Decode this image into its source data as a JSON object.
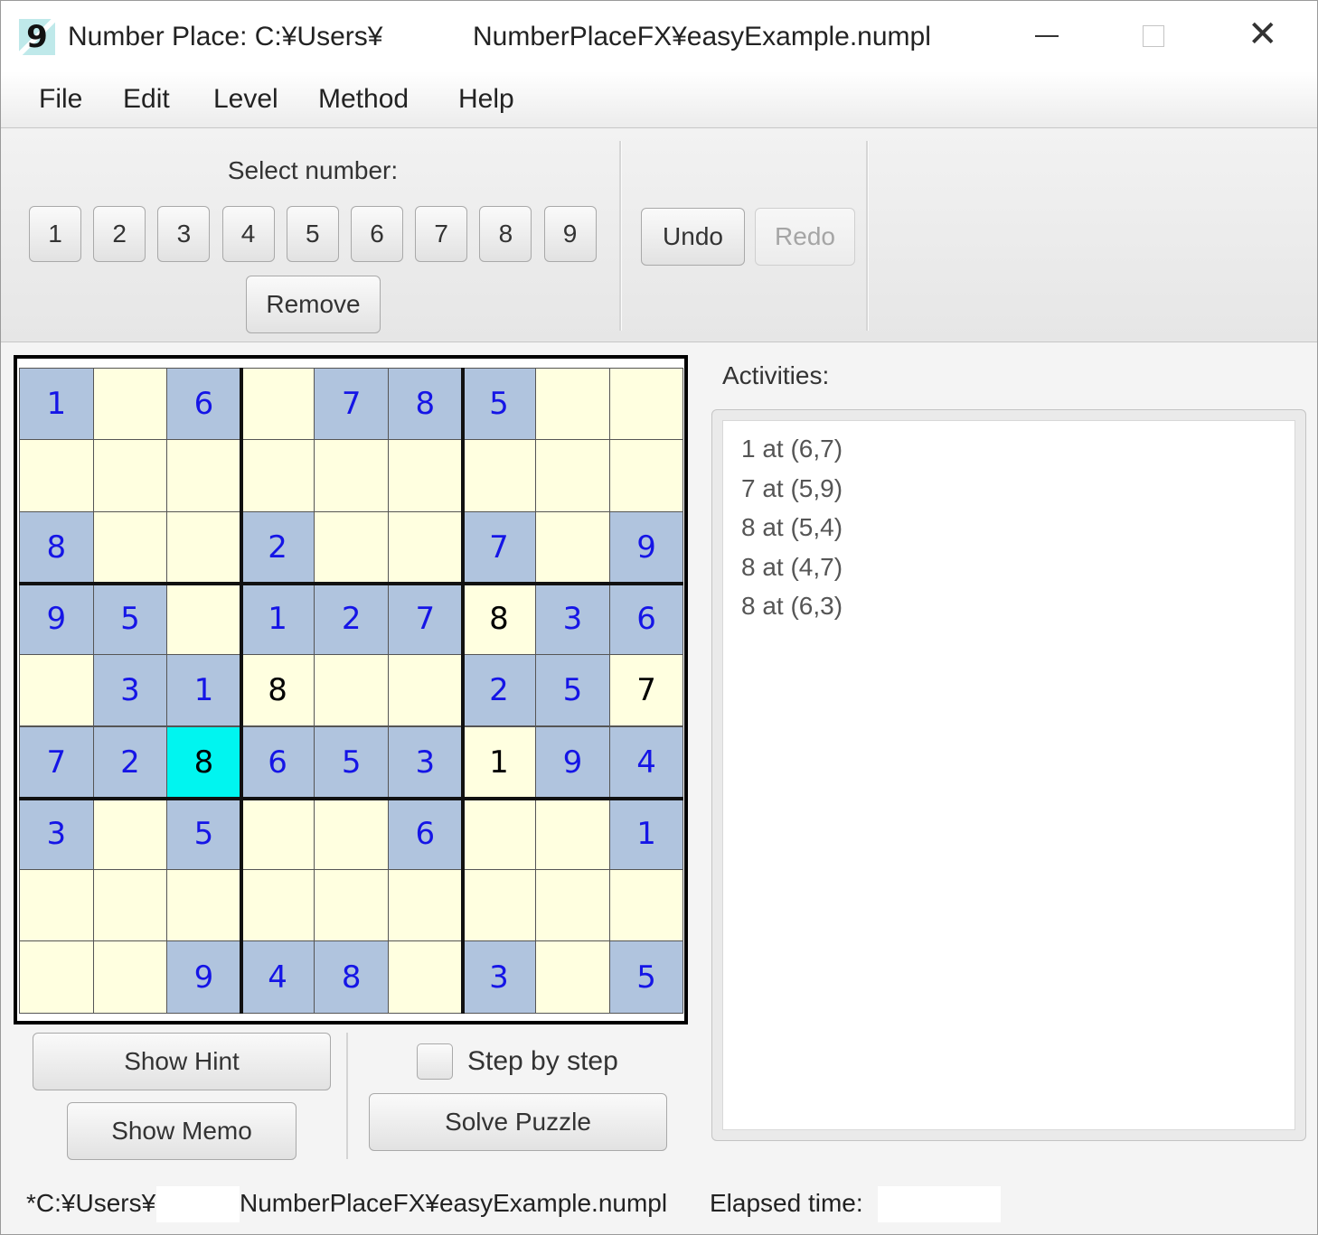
{
  "window": {
    "app_icon": "9",
    "title_left": "Number Place: C:¥Users¥",
    "title_right": "NumberPlaceFX¥easyExample.numpl",
    "close_glyph": "✕"
  },
  "menu": [
    "File",
    "Edit",
    "Level",
    "Method",
    "Help"
  ],
  "toolbar": {
    "select_label": "Select number:",
    "numbers": [
      "1",
      "2",
      "3",
      "4",
      "5",
      "6",
      "7",
      "8",
      "9"
    ],
    "remove_label": "Remove",
    "undo_label": "Undo",
    "redo_label": "Redo"
  },
  "board": {
    "rows": [
      [
        "1",
        "",
        "6",
        "",
        "7",
        "8",
        "5",
        "",
        ""
      ],
      [
        "",
        "",
        "",
        "",
        "",
        "",
        "",
        "",
        ""
      ],
      [
        "8",
        "",
        "",
        "2",
        "",
        "",
        "7",
        "",
        "9"
      ],
      [
        "9",
        "5",
        "",
        "1",
        "2",
        "7",
        "8",
        "3",
        "6"
      ],
      [
        "",
        "3",
        "1",
        "8",
        "",
        "",
        "2",
        "5",
        "7"
      ],
      [
        "7",
        "2",
        "8",
        "6",
        "5",
        "3",
        "1",
        "9",
        "4"
      ],
      [
        "3",
        "",
        "5",
        "",
        "",
        "6",
        "",
        "",
        "1"
      ],
      [
        "",
        "",
        "",
        "",
        "",
        "",
        "",
        "",
        ""
      ],
      [
        "",
        "",
        "9",
        "4",
        "8",
        "",
        "3",
        "",
        "5"
      ]
    ],
    "user_cells": [
      [
        3,
        6
      ],
      [
        4,
        3
      ],
      [
        4,
        8
      ],
      [
        5,
        2
      ],
      [
        5,
        6
      ]
    ],
    "selected_cell": [
      5,
      2
    ],
    "colors": {
      "given_bg": "#b0c4de",
      "given_text": "#1515e6",
      "empty_bg": "#ffffe0",
      "selected_bg": "#00f5f0"
    }
  },
  "controls": {
    "show_hint": "Show Hint",
    "show_memo": "Show Memo",
    "step_by_step": "Step by step",
    "solve_puzzle": "Solve Puzzle"
  },
  "activities": {
    "label": "Activities:",
    "items": [
      "1 at (6,7)",
      "7 at (5,9)",
      "8 at (5,4)",
      "8 at (4,7)",
      "8 at (6,3)"
    ]
  },
  "status": {
    "path_left": "*C:¥Users¥",
    "path_right": "NumberPlaceFX¥easyExample.numpl",
    "elapsed_label": "Elapsed time:"
  }
}
